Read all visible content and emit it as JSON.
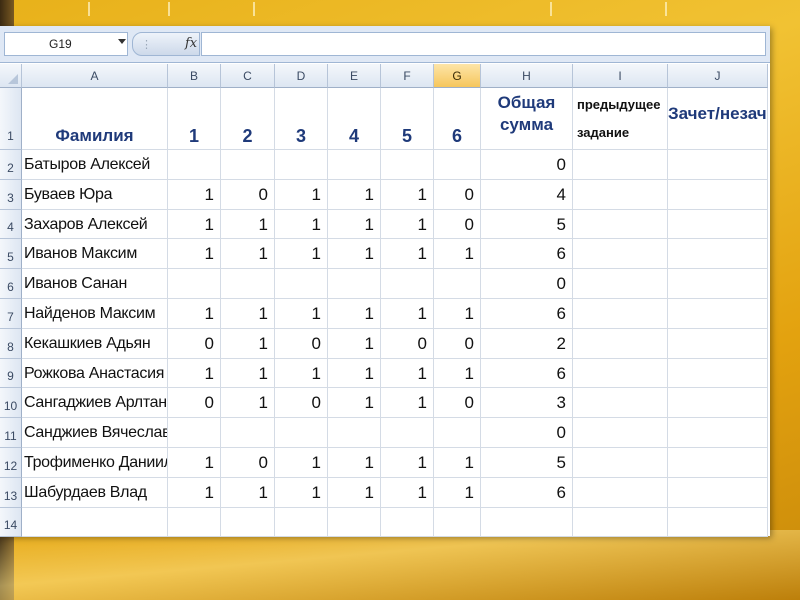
{
  "formula_bar": {
    "name_box": "G19",
    "fx": "fx",
    "formula": ""
  },
  "columns": [
    "A",
    "B",
    "C",
    "D",
    "E",
    "F",
    "G",
    "H",
    "I",
    "J"
  ],
  "active_column": "G",
  "header_row": {
    "row": "1",
    "family": "Фамилия",
    "tasks": [
      "1",
      "2",
      "3",
      "4",
      "5",
      "6"
    ],
    "total_line1": "Общая",
    "total_line2": "сумма",
    "prev_line1": "предыдущее",
    "prev_line2": "задание",
    "pass": "Зачет/незачет"
  },
  "rows": [
    {
      "row": "2",
      "name": "Батыров Алексей",
      "scores": [
        "",
        "",
        "",
        "",
        "",
        ""
      ],
      "total": "0"
    },
    {
      "row": "3",
      "name": "Буваев Юра",
      "scores": [
        "1",
        "0",
        "1",
        "1",
        "1",
        "0"
      ],
      "total": "4"
    },
    {
      "row": "4",
      "name": "Захаров Алексей",
      "scores": [
        "1",
        "1",
        "1",
        "1",
        "1",
        "0"
      ],
      "total": "5"
    },
    {
      "row": "5",
      "name": "Иванов Максим",
      "scores": [
        "1",
        "1",
        "1",
        "1",
        "1",
        "1"
      ],
      "total": "6"
    },
    {
      "row": "6",
      "name": "Иванов Санан",
      "scores": [
        "",
        "",
        "",
        "",
        "",
        ""
      ],
      "total": "0"
    },
    {
      "row": "7",
      "name": "Найденов Максим",
      "scores": [
        "1",
        "1",
        "1",
        "1",
        "1",
        "1"
      ],
      "total": "6"
    },
    {
      "row": "8",
      "name": "Кекашкиев Адьян",
      "scores": [
        "0",
        "1",
        "0",
        "1",
        "0",
        "0"
      ],
      "total": "2"
    },
    {
      "row": "9",
      "name": "Рожкова Анастасия",
      "scores": [
        "1",
        "1",
        "1",
        "1",
        "1",
        "1"
      ],
      "total": "6"
    },
    {
      "row": "10",
      "name": "Сангаджиев Арлтан",
      "scores": [
        "0",
        "1",
        "0",
        "1",
        "1",
        "0"
      ],
      "total": "3"
    },
    {
      "row": "11",
      "name": "Санджиев Вячеслав",
      "scores": [
        "",
        "",
        "",
        "",
        "",
        ""
      ],
      "total": "0"
    },
    {
      "row": "12",
      "name": "Трофименко Даниил",
      "scores": [
        "1",
        "0",
        "1",
        "1",
        "1",
        "1"
      ],
      "total": "5"
    },
    {
      "row": "13",
      "name": "Шабурдаев Влад",
      "scores": [
        "1",
        "1",
        "1",
        "1",
        "1",
        "1"
      ],
      "total": "6"
    },
    {
      "row": "14",
      "name": "",
      "scores": [
        "",
        "",
        "",
        "",
        "",
        ""
      ],
      "total": ""
    }
  ]
}
